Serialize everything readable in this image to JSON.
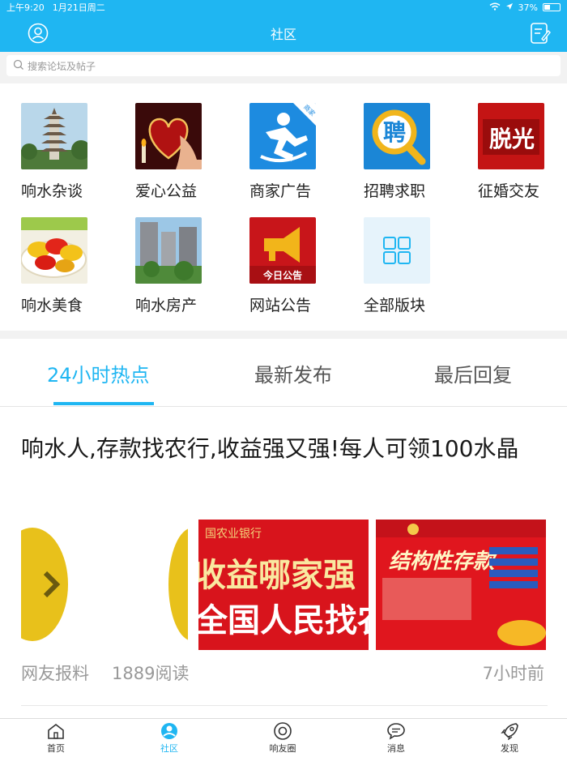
{
  "status": {
    "time": "上午9:20",
    "date": "1月21日周二",
    "battery": "37%",
    "battery_level": 0.37
  },
  "nav": {
    "title": "社区"
  },
  "search": {
    "placeholder": "搜索论坛及帖子"
  },
  "boards": [
    {
      "label": "响水杂谈",
      "icon": "pagoda-photo"
    },
    {
      "label": "爱心公益",
      "icon": "heart-photo"
    },
    {
      "label": "商家广告",
      "icon": "merchant-runner-icon",
      "badge": "商家"
    },
    {
      "label": "招聘求职",
      "icon": "recruit-magnifier-icon",
      "glyph": "聘"
    },
    {
      "label": "征婚交友",
      "icon": "calligraphy-photo",
      "glyph": "脱光"
    },
    {
      "label": "响水美食",
      "icon": "food-photo"
    },
    {
      "label": "响水房产",
      "icon": "buildings-photo"
    },
    {
      "label": "网站公告",
      "icon": "megaphone-icon",
      "caption": "今日公告"
    },
    {
      "label": "全部版块",
      "icon": "grid-icon"
    }
  ],
  "tabs": [
    "24小时热点",
    "最新发布",
    "最后回复"
  ],
  "post": {
    "title": "响水人,存款找农行,收益强又强!每人可领100水晶",
    "source": "网友报料",
    "reads": "1889阅读",
    "time": "7小时前",
    "banner1": "收益哪家强",
    "banner1b": "全国人民找农",
    "banner2": "结构性存款"
  },
  "tabbar": [
    {
      "label": "首页",
      "icon": "home-icon"
    },
    {
      "label": "社区",
      "icon": "community-icon"
    },
    {
      "label": "响友圈",
      "icon": "circle-icon"
    },
    {
      "label": "消息",
      "icon": "message-icon"
    },
    {
      "label": "发现",
      "icon": "rocket-icon"
    }
  ],
  "colors": {
    "accent": "#1fb6f2",
    "banner_red": "#d8141c"
  }
}
